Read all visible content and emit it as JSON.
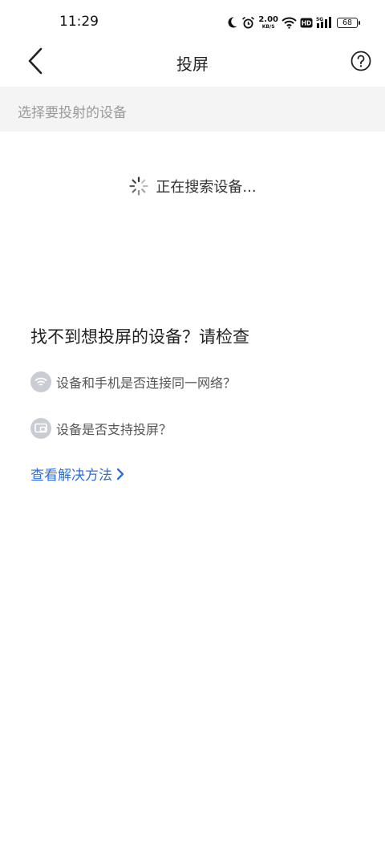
{
  "status_bar": {
    "time": "11:29",
    "net_speed_value": "2.00",
    "net_speed_unit": "KB/S",
    "hd_label": "HD",
    "signal_label": "5G",
    "battery_level": "68",
    "icons": [
      "moon-icon",
      "alarm-icon",
      "wifi-icon",
      "hd-icon",
      "signal-icon",
      "battery-icon"
    ]
  },
  "nav": {
    "title": "投屏",
    "back_icon": "chevron-left-icon",
    "help_icon": "question-circle-icon"
  },
  "device_section": {
    "header": "选择要投射的设备",
    "searching_text": "正在搜索设备..."
  },
  "tips": {
    "title": "找不到想投屏的设备？请检查",
    "items": [
      {
        "icon": "wifi-icon",
        "text": "设备和手机是否连接同一网络？"
      },
      {
        "icon": "cast-icon",
        "text": "设备是否支持投屏？"
      }
    ],
    "link_label": "查看解决方法"
  },
  "colors": {
    "accent_link": "#2f6fd6",
    "section_bg": "#f4f4f4",
    "tip_icon_bg": "#c9ccd3"
  }
}
